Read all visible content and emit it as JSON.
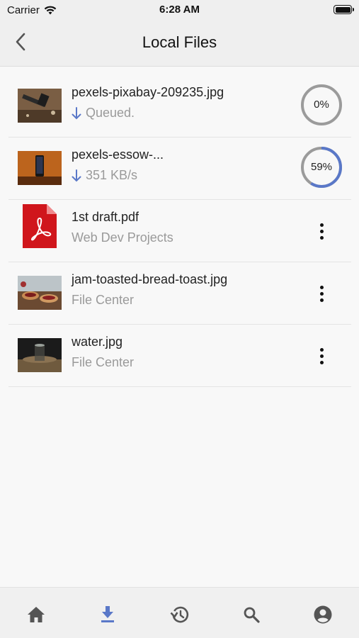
{
  "status_bar": {
    "carrier": "Carrier",
    "time": "6:28 AM"
  },
  "nav": {
    "title": "Local Files",
    "back_icon": "chevron-left-icon"
  },
  "files": [
    {
      "name": "pexels-pixabay-209235.jpg",
      "status": "Queued.",
      "downloading": true,
      "progress": 0,
      "progress_label": "0%"
    },
    {
      "name": "pexels-essow-...",
      "status": "351 KB/s",
      "downloading": true,
      "progress": 59,
      "progress_label": "59%"
    },
    {
      "name": "1st draft.pdf",
      "subtitle": "Web Dev Projects",
      "downloading": false
    },
    {
      "name": "jam-toasted-bread-toast.jpg",
      "subtitle": "File Center",
      "downloading": false
    },
    {
      "name": "water.jpg",
      "subtitle": "File Center",
      "downloading": false
    }
  ],
  "tabs": [
    {
      "icon": "home-icon",
      "active": false
    },
    {
      "icon": "download-icon",
      "active": true
    },
    {
      "icon": "history-icon",
      "active": false
    },
    {
      "icon": "search-icon",
      "active": false
    },
    {
      "icon": "account-icon",
      "active": false
    }
  ],
  "colors": {
    "accent": "#5a78c8",
    "inactive_icon": "#555555",
    "pdf_red": "#d0161c",
    "ring_track": "#9b9b9b"
  }
}
